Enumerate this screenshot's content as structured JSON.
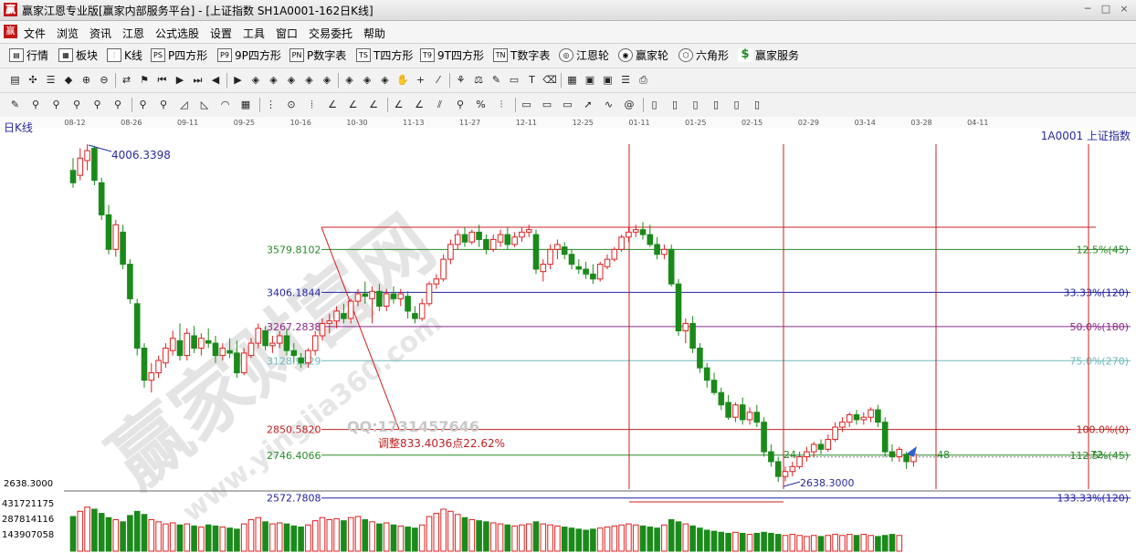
{
  "window": {
    "title": "赢家江恩专业版[赢家内部服务平台] - [上证指数  SH1A0001-162日K线]",
    "logo": "赢",
    "controls": [
      "─",
      "□",
      "×"
    ]
  },
  "menu": {
    "logo": "赢",
    "items": [
      "文件",
      "浏览",
      "资讯",
      "江恩",
      "公式选股",
      "设置",
      "工具",
      "窗口",
      "交易委托",
      "帮助"
    ]
  },
  "toolbar1": [
    {
      "icon": "quotes-icon",
      "glyph": "▤",
      "label": "行情"
    },
    {
      "icon": "sectors-icon",
      "glyph": "▦",
      "label": "板块"
    },
    {
      "icon": "kline-icon",
      "glyph": "⫶",
      "label": "K线"
    },
    {
      "icon": "p-square-icon",
      "glyph": "PS",
      "label": "P四方形"
    },
    {
      "icon": "9p-square-icon",
      "glyph": "P9",
      "label": "9P四方形"
    },
    {
      "icon": "p-number-table-icon",
      "glyph": "PN",
      "label": "P数字表"
    },
    {
      "icon": "t-square-icon",
      "glyph": "TS",
      "label": "T四方形"
    },
    {
      "icon": "9t-square-icon",
      "glyph": "T9",
      "label": "9T四方形"
    },
    {
      "icon": "t-number-table-icon",
      "glyph": "TN",
      "label": "T数字表"
    },
    {
      "icon": "gann-wheel-icon",
      "glyph": "◎",
      "label": "江恩轮"
    },
    {
      "icon": "winner-wheel-icon",
      "glyph": "◉",
      "label": "赢家轮"
    },
    {
      "icon": "hexagon-icon",
      "glyph": "⬡",
      "label": "六角形"
    },
    {
      "icon": "dollar-icon",
      "glyph": "$",
      "label": "赢家服务"
    }
  ],
  "toolbar2_icons": [
    "period-dropdown-icon",
    "chart-type-icon",
    "document-icon",
    "stock-icon",
    "zoom-in-icon",
    "zoom-out-icon",
    "swap-icon",
    "flag-icon",
    "first-icon",
    "play-icon",
    "last-icon",
    "prev-icon",
    "next-icon",
    "diamond1-icon",
    "diamond2-icon",
    "diamond3-icon",
    "diamond4-icon",
    "diamond5-icon",
    "diamond6-icon",
    "diamond7-icon",
    "diamond8-icon",
    "hand-icon",
    "cross-icon",
    "line-tool-icon",
    "tree-icon",
    "scale-icon",
    "label-tool-icon",
    "box-tool-icon",
    "text-tool-icon",
    "erase-icon",
    "calendar-icon",
    "window-icon",
    "save-icon",
    "list-icon",
    "print-icon"
  ],
  "toolbar3_icons": [
    "pencil-icon",
    "fork1-icon",
    "fork2-icon",
    "fork3-icon",
    "fork4-icon",
    "fork5-icon",
    "fork6-icon",
    "fork7-icon",
    "fan1-icon",
    "fan2-icon",
    "arc-icon",
    "gann-grid-icon",
    "fib-icon",
    "cycle-icon",
    "time-zone-icon",
    "angle1-icon",
    "angle2-icon",
    "angle3-icon",
    "angle4-icon",
    "angle5-icon",
    "channel-icon",
    "fork8-icon",
    "percent-icon",
    "band-icon",
    "box1-icon",
    "box2-icon",
    "box3-icon",
    "arrow-icon",
    "wave-icon",
    "spiral-icon",
    "rect1-icon",
    "rect2-icon",
    "rect3-icon",
    "rect4-icon",
    "rect5-icon",
    "rect6-icon"
  ],
  "chart_data": {
    "type": "candlestick",
    "panel_label": "日K线",
    "symbol_label": "1A0001  上证指数",
    "x_date_ticks": [
      "08-12",
      "08-26",
      "09-11",
      "09-25",
      "10-16",
      "10-30",
      "11-13",
      "11-27",
      "12-11",
      "12-25",
      "01-11",
      "01-25",
      "02-15",
      "02-29",
      "03-14",
      "03-28",
      "04-11"
    ],
    "y_range": [
      2500,
      4150
    ],
    "high_label": "4006.3398",
    "low_label": "2638.3000",
    "left_low_label": "2638.3000",
    "volume_axis_labels": [
      "431721175",
      "287814116",
      "143907058"
    ],
    "fib_levels": [
      {
        "price": 3579.8102,
        "price_label": "3579.8102",
        "pct_label": "12.5%(45)",
        "color": "#2a8a2a"
      },
      {
        "price": 3406.1844,
        "price_label": "3406.1844",
        "pct_label": "33.33%(120)",
        "color": "#2222a0"
      },
      {
        "price": 3267.2838,
        "price_label": "3267.2838",
        "pct_label": "50.0%(180)",
        "color": "#8a2a8a"
      },
      {
        "price": 3128.9329,
        "price_label": "3128.9329",
        "pct_label": "75.0%(270)",
        "color": "#6fb9bd"
      },
      {
        "price": 2850.582,
        "price_label": "2850.5820",
        "pct_label": "100.0%(0)",
        "color": "#c02020"
      },
      {
        "price": 2746.4066,
        "price_label": "2746.4066",
        "pct_label": "112.5%(45)",
        "color": "#2a8a2a"
      },
      {
        "price": 2572.7808,
        "price_label": "2572.7808",
        "pct_label": "133.33%(120)",
        "color": "#2222a0"
      }
    ],
    "annotations": {
      "adjustment": "调整833.4036点22.62%",
      "watermark_main": "赢家财富网",
      "watermark_url": "www.yingjia360.com",
      "qq": "QQ:1731457646",
      "count_24": "24",
      "count_48": "48",
      "count_72": "72"
    },
    "candles": [
      [
        3900,
        3950,
        3850,
        3830
      ],
      [
        3880,
        3990,
        3950,
        3860
      ],
      [
        3940,
        4006,
        3980,
        3900
      ],
      [
        3990,
        4000,
        3860,
        3840
      ],
      [
        3850,
        3870,
        3720,
        3700
      ],
      [
        3720,
        3760,
        3580,
        3560
      ],
      [
        3580,
        3700,
        3680,
        3550
      ],
      [
        3650,
        3680,
        3520,
        3500
      ],
      [
        3520,
        3540,
        3380,
        3360
      ],
      [
        3360,
        3380,
        3180,
        3150
      ],
      [
        3180,
        3200,
        3050,
        3020
      ],
      [
        3050,
        3120,
        3080,
        3000
      ],
      [
        3080,
        3150,
        3130,
        3060
      ],
      [
        3120,
        3200,
        3180,
        3100
      ],
      [
        3170,
        3250,
        3220,
        3150
      ],
      [
        3210,
        3280,
        3150,
        3130
      ],
      [
        3150,
        3260,
        3240,
        3130
      ],
      [
        3230,
        3270,
        3180,
        3160
      ],
      [
        3180,
        3240,
        3220,
        3150
      ],
      [
        3210,
        3260,
        3200,
        3180
      ],
      [
        3200,
        3230,
        3150,
        3120
      ],
      [
        3150,
        3200,
        3180,
        3130
      ],
      [
        3170,
        3220,
        3160,
        3140
      ],
      [
        3160,
        3210,
        3080,
        3060
      ],
      [
        3080,
        3180,
        3160,
        3070
      ],
      [
        3150,
        3220,
        3200,
        3140
      ],
      [
        3200,
        3280,
        3260,
        3180
      ],
      [
        3250,
        3270,
        3190,
        3170
      ],
      [
        3190,
        3230,
        3200,
        3160
      ],
      [
        3200,
        3250,
        3230,
        3180
      ],
      [
        3230,
        3260,
        3170,
        3150
      ],
      [
        3170,
        3200,
        3150,
        3120
      ],
      [
        3140,
        3160,
        3120,
        3100
      ],
      [
        3120,
        3180,
        3170,
        3100
      ],
      [
        3170,
        3250,
        3230,
        3150
      ],
      [
        3230,
        3300,
        3280,
        3210
      ],
      [
        3280,
        3320,
        3290,
        3240
      ],
      [
        3290,
        3350,
        3330,
        3260
      ],
      [
        3320,
        3360,
        3300,
        3280
      ],
      [
        3300,
        3380,
        3370,
        3280
      ],
      [
        3370,
        3420,
        3400,
        3350
      ],
      [
        3400,
        3450,
        3390,
        3360
      ],
      [
        3380,
        3430,
        3410,
        3280
      ],
      [
        3410,
        3440,
        3350,
        3330
      ],
      [
        3350,
        3420,
        3400,
        3330
      ],
      [
        3400,
        3430,
        3380,
        3360
      ],
      [
        3380,
        3420,
        3400,
        3350
      ],
      [
        3390,
        3410,
        3330,
        3300
      ],
      [
        3320,
        3350,
        3300,
        3280
      ],
      [
        3300,
        3380,
        3360,
        3290
      ],
      [
        3360,
        3450,
        3440,
        3350
      ],
      [
        3440,
        3480,
        3460,
        3420
      ],
      [
        3460,
        3560,
        3540,
        3450
      ],
      [
        3540,
        3620,
        3600,
        3520
      ],
      [
        3600,
        3660,
        3640,
        3580
      ],
      [
        3640,
        3670,
        3610,
        3590
      ],
      [
        3610,
        3660,
        3650,
        3600
      ],
      [
        3650,
        3680,
        3620,
        3590
      ],
      [
        3620,
        3640,
        3580,
        3560
      ],
      [
        3580,
        3640,
        3620,
        3570
      ],
      [
        3610,
        3660,
        3640,
        3590
      ],
      [
        3640,
        3670,
        3600,
        3580
      ],
      [
        3600,
        3650,
        3630,
        3590
      ],
      [
        3630,
        3670,
        3650,
        3610
      ],
      [
        3650,
        3680,
        3660,
        3630
      ],
      [
        3640,
        3660,
        3500,
        3480
      ],
      [
        3490,
        3540,
        3520,
        3450
      ],
      [
        3520,
        3600,
        3580,
        3500
      ],
      [
        3580,
        3620,
        3600,
        3540
      ],
      [
        3590,
        3610,
        3560,
        3540
      ],
      [
        3560,
        3580,
        3520,
        3500
      ],
      [
        3510,
        3540,
        3500,
        3480
      ],
      [
        3500,
        3530,
        3480,
        3460
      ],
      [
        3480,
        3520,
        3460,
        3440
      ],
      [
        3460,
        3530,
        3520,
        3450
      ],
      [
        3510,
        3560,
        3540,
        3500
      ],
      [
        3540,
        3590,
        3580,
        3530
      ],
      [
        3580,
        3640,
        3630,
        3570
      ],
      [
        3630,
        3670,
        3650,
        3610
      ],
      [
        3650,
        3680,
        3660,
        3630
      ],
      [
        3660,
        3690,
        3640,
        3620
      ],
      [
        3640,
        3680,
        3600,
        3590
      ],
      [
        3600,
        3630,
        3560,
        3540
      ],
      [
        3560,
        3600,
        3580,
        3540
      ],
      [
        3580,
        3600,
        3440,
        3430
      ],
      [
        3440,
        3460,
        3250,
        3230
      ],
      [
        3250,
        3300,
        3280,
        3200
      ],
      [
        3280,
        3310,
        3180,
        3160
      ],
      [
        3180,
        3200,
        3100,
        3080
      ],
      [
        3100,
        3120,
        3050,
        3020
      ],
      [
        3050,
        3080,
        3000,
        2990
      ],
      [
        3000,
        3020,
        2950,
        2930
      ],
      [
        2960,
        2990,
        2900,
        2890
      ],
      [
        2900,
        2960,
        2950,
        2880
      ],
      [
        2950,
        2980,
        2890,
        2870
      ],
      [
        2890,
        2940,
        2920,
        2870
      ],
      [
        2920,
        2950,
        2880,
        2860
      ],
      [
        2880,
        2900,
        2760,
        2740
      ],
      [
        2760,
        2790,
        2720,
        2700
      ],
      [
        2720,
        2740,
        2660,
        2638
      ],
      [
        2660,
        2700,
        2680,
        2640
      ],
      [
        2680,
        2720,
        2700,
        2660
      ],
      [
        2700,
        2760,
        2740,
        2690
      ],
      [
        2740,
        2780,
        2760,
        2720
      ],
      [
        2760,
        2800,
        2790,
        2740
      ],
      [
        2790,
        2810,
        2770,
        2750
      ],
      [
        2770,
        2830,
        2810,
        2760
      ],
      [
        2810,
        2880,
        2860,
        2800
      ],
      [
        2860,
        2900,
        2880,
        2840
      ],
      [
        2880,
        2920,
        2910,
        2860
      ],
      [
        2910,
        2930,
        2890,
        2870
      ],
      [
        2890,
        2920,
        2900,
        2870
      ],
      [
        2900,
        2940,
        2930,
        2880
      ],
      [
        2930,
        2950,
        2880,
        2860
      ],
      [
        2880,
        2900,
        2760,
        2740
      ],
      [
        2760,
        2790,
        2740,
        2720
      ],
      [
        2740,
        2780,
        2770,
        2720
      ],
      [
        2750,
        2760,
        2720,
        2690
      ],
      [
        2720,
        2760,
        2750,
        2700
      ]
    ],
    "volumes": [
      330,
      380,
      420,
      400,
      360,
      320,
      300,
      280,
      340,
      380,
      350,
      300,
      280,
      260,
      270,
      250,
      260,
      240,
      230,
      250,
      240,
      230,
      220,
      210,
      260,
      300,
      320,
      280,
      260,
      270,
      260,
      240,
      230,
      250,
      290,
      320,
      300,
      310,
      290,
      320,
      330,
      300,
      280,
      260,
      270,
      250,
      240,
      230,
      220,
      250,
      330,
      360,
      400,
      380,
      350,
      320,
      300,
      290,
      280,
      270,
      260,
      250,
      240,
      250,
      260,
      280,
      260,
      250,
      240,
      230,
      220,
      210,
      200,
      210,
      220,
      230,
      240,
      250,
      260,
      250,
      240,
      230,
      220,
      250,
      300,
      280,
      260,
      240,
      220,
      200,
      190,
      180,
      170,
      180,
      170,
      160,
      170,
      180,
      170,
      160,
      150,
      160,
      150,
      140,
      150,
      140,
      150,
      160,
      150,
      160,
      150,
      160,
      150,
      140,
      150,
      160,
      150
    ]
  }
}
